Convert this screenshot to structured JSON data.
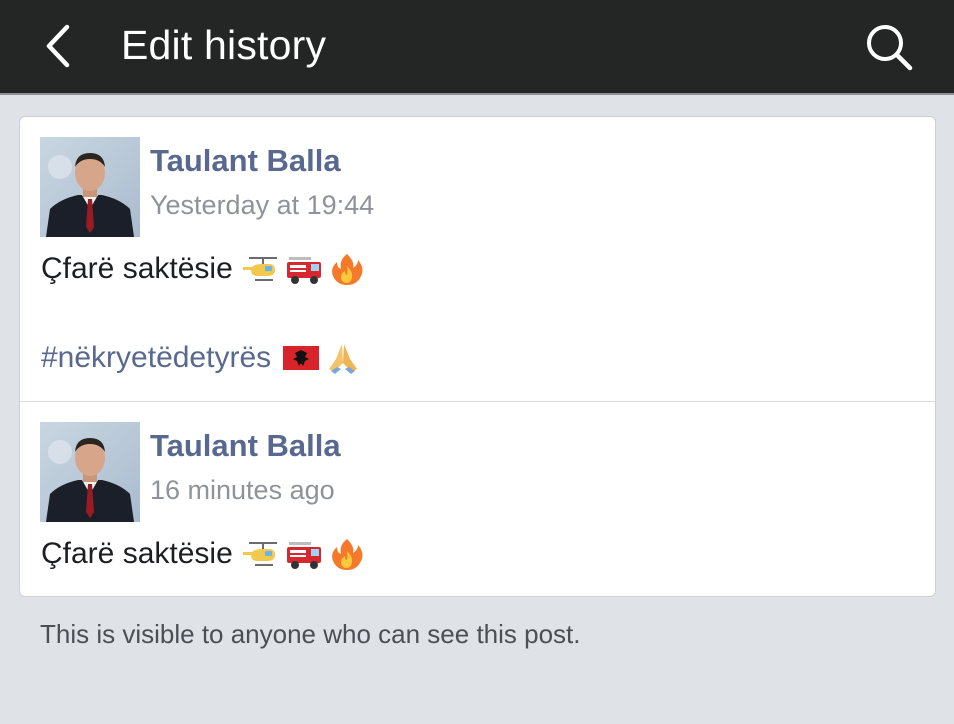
{
  "header": {
    "title": "Edit history",
    "back_icon": "chevron-left-icon",
    "search_icon": "search-icon",
    "background": "#242625"
  },
  "history": [
    {
      "author": "Taulant Balla",
      "timestamp": "Yesterday at 19:44",
      "text": "Çfarë saktësie",
      "emojis": [
        "helicopter-emoji",
        "fire-engine-emoji",
        "fire-emoji"
      ],
      "hashtag": "#nëkryetëdetyrës",
      "hashtag_emojis": [
        "albania-flag-emoji",
        "folded-hands-emoji"
      ]
    },
    {
      "author": "Taulant Balla",
      "timestamp": "16 minutes ago",
      "text": "Çfarë saktësie",
      "emojis": [
        "helicopter-emoji",
        "fire-engine-emoji",
        "fire-emoji"
      ]
    }
  ],
  "footer": {
    "note": "This is visible to anyone who can see this post."
  },
  "colors": {
    "author_link": "#58688e",
    "page_background": "#dfe2e6"
  }
}
